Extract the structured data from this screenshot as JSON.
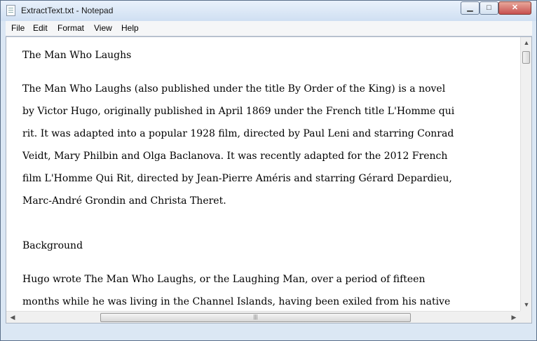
{
  "window": {
    "title": "ExtractText.txt - Notepad"
  },
  "controls": {
    "minimize": "▁",
    "maximize": "□",
    "close": "✕"
  },
  "menu": [
    "File",
    "Edit",
    "Format",
    "View",
    "Help"
  ],
  "document": {
    "lines": [
      "The Man Who Laughs",
      "",
      "The Man Who Laughs (also published under the title By Order of the King) is a novel",
      "by Victor Hugo, originally published in April 1869 under the French title L'Homme qui",
      "rit. It was adapted into a popular 1928 film, directed by Paul Leni and starring Conrad",
      "Veidt, Mary Philbin and Olga Baclanova. It was recently adapted for the 2012 French",
      "film L'Homme Qui Rit, directed by Jean-Pierre Améris and starring Gérard Depardieu,",
      "Marc-André Grondin and Christa Theret.",
      "",
      "",
      "Background",
      "",
      "Hugo wrote The Man Who Laughs, or the Laughing Man, over a period of fifteen",
      "months while he was living in the Channel Islands, having been exiled from his native"
    ]
  },
  "scrollbars": {
    "up_arrow": "▲",
    "down_arrow": "▼",
    "left_arrow": "◀",
    "right_arrow": "▶",
    "grip": "|||"
  }
}
